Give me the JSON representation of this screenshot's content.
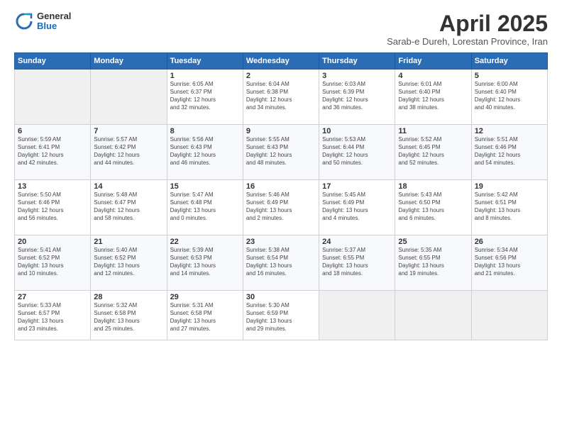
{
  "logo": {
    "general": "General",
    "blue": "Blue"
  },
  "header": {
    "title": "April 2025",
    "subtitle": "Sarab-e Dureh, Lorestan Province, Iran"
  },
  "days_header": [
    "Sunday",
    "Monday",
    "Tuesday",
    "Wednesday",
    "Thursday",
    "Friday",
    "Saturday"
  ],
  "weeks": [
    [
      {
        "day": "",
        "info": ""
      },
      {
        "day": "",
        "info": ""
      },
      {
        "day": "1",
        "info": "Sunrise: 6:05 AM\nSunset: 6:37 PM\nDaylight: 12 hours\nand 32 minutes."
      },
      {
        "day": "2",
        "info": "Sunrise: 6:04 AM\nSunset: 6:38 PM\nDaylight: 12 hours\nand 34 minutes."
      },
      {
        "day": "3",
        "info": "Sunrise: 6:03 AM\nSunset: 6:39 PM\nDaylight: 12 hours\nand 36 minutes."
      },
      {
        "day": "4",
        "info": "Sunrise: 6:01 AM\nSunset: 6:40 PM\nDaylight: 12 hours\nand 38 minutes."
      },
      {
        "day": "5",
        "info": "Sunrise: 6:00 AM\nSunset: 6:40 PM\nDaylight: 12 hours\nand 40 minutes."
      }
    ],
    [
      {
        "day": "6",
        "info": "Sunrise: 5:59 AM\nSunset: 6:41 PM\nDaylight: 12 hours\nand 42 minutes."
      },
      {
        "day": "7",
        "info": "Sunrise: 5:57 AM\nSunset: 6:42 PM\nDaylight: 12 hours\nand 44 minutes."
      },
      {
        "day": "8",
        "info": "Sunrise: 5:56 AM\nSunset: 6:43 PM\nDaylight: 12 hours\nand 46 minutes."
      },
      {
        "day": "9",
        "info": "Sunrise: 5:55 AM\nSunset: 6:43 PM\nDaylight: 12 hours\nand 48 minutes."
      },
      {
        "day": "10",
        "info": "Sunrise: 5:53 AM\nSunset: 6:44 PM\nDaylight: 12 hours\nand 50 minutes."
      },
      {
        "day": "11",
        "info": "Sunrise: 5:52 AM\nSunset: 6:45 PM\nDaylight: 12 hours\nand 52 minutes."
      },
      {
        "day": "12",
        "info": "Sunrise: 5:51 AM\nSunset: 6:46 PM\nDaylight: 12 hours\nand 54 minutes."
      }
    ],
    [
      {
        "day": "13",
        "info": "Sunrise: 5:50 AM\nSunset: 6:46 PM\nDaylight: 12 hours\nand 56 minutes."
      },
      {
        "day": "14",
        "info": "Sunrise: 5:48 AM\nSunset: 6:47 PM\nDaylight: 12 hours\nand 58 minutes."
      },
      {
        "day": "15",
        "info": "Sunrise: 5:47 AM\nSunset: 6:48 PM\nDaylight: 13 hours\nand 0 minutes."
      },
      {
        "day": "16",
        "info": "Sunrise: 5:46 AM\nSunset: 6:49 PM\nDaylight: 13 hours\nand 2 minutes."
      },
      {
        "day": "17",
        "info": "Sunrise: 5:45 AM\nSunset: 6:49 PM\nDaylight: 13 hours\nand 4 minutes."
      },
      {
        "day": "18",
        "info": "Sunrise: 5:43 AM\nSunset: 6:50 PM\nDaylight: 13 hours\nand 6 minutes."
      },
      {
        "day": "19",
        "info": "Sunrise: 5:42 AM\nSunset: 6:51 PM\nDaylight: 13 hours\nand 8 minutes."
      }
    ],
    [
      {
        "day": "20",
        "info": "Sunrise: 5:41 AM\nSunset: 6:52 PM\nDaylight: 13 hours\nand 10 minutes."
      },
      {
        "day": "21",
        "info": "Sunrise: 5:40 AM\nSunset: 6:52 PM\nDaylight: 13 hours\nand 12 minutes."
      },
      {
        "day": "22",
        "info": "Sunrise: 5:39 AM\nSunset: 6:53 PM\nDaylight: 13 hours\nand 14 minutes."
      },
      {
        "day": "23",
        "info": "Sunrise: 5:38 AM\nSunset: 6:54 PM\nDaylight: 13 hours\nand 16 minutes."
      },
      {
        "day": "24",
        "info": "Sunrise: 5:37 AM\nSunset: 6:55 PM\nDaylight: 13 hours\nand 18 minutes."
      },
      {
        "day": "25",
        "info": "Sunrise: 5:35 AM\nSunset: 6:55 PM\nDaylight: 13 hours\nand 19 minutes."
      },
      {
        "day": "26",
        "info": "Sunrise: 5:34 AM\nSunset: 6:56 PM\nDaylight: 13 hours\nand 21 minutes."
      }
    ],
    [
      {
        "day": "27",
        "info": "Sunrise: 5:33 AM\nSunset: 6:57 PM\nDaylight: 13 hours\nand 23 minutes."
      },
      {
        "day": "28",
        "info": "Sunrise: 5:32 AM\nSunset: 6:58 PM\nDaylight: 13 hours\nand 25 minutes."
      },
      {
        "day": "29",
        "info": "Sunrise: 5:31 AM\nSunset: 6:58 PM\nDaylight: 13 hours\nand 27 minutes."
      },
      {
        "day": "30",
        "info": "Sunrise: 5:30 AM\nSunset: 6:59 PM\nDaylight: 13 hours\nand 29 minutes."
      },
      {
        "day": "",
        "info": ""
      },
      {
        "day": "",
        "info": ""
      },
      {
        "day": "",
        "info": ""
      }
    ]
  ]
}
